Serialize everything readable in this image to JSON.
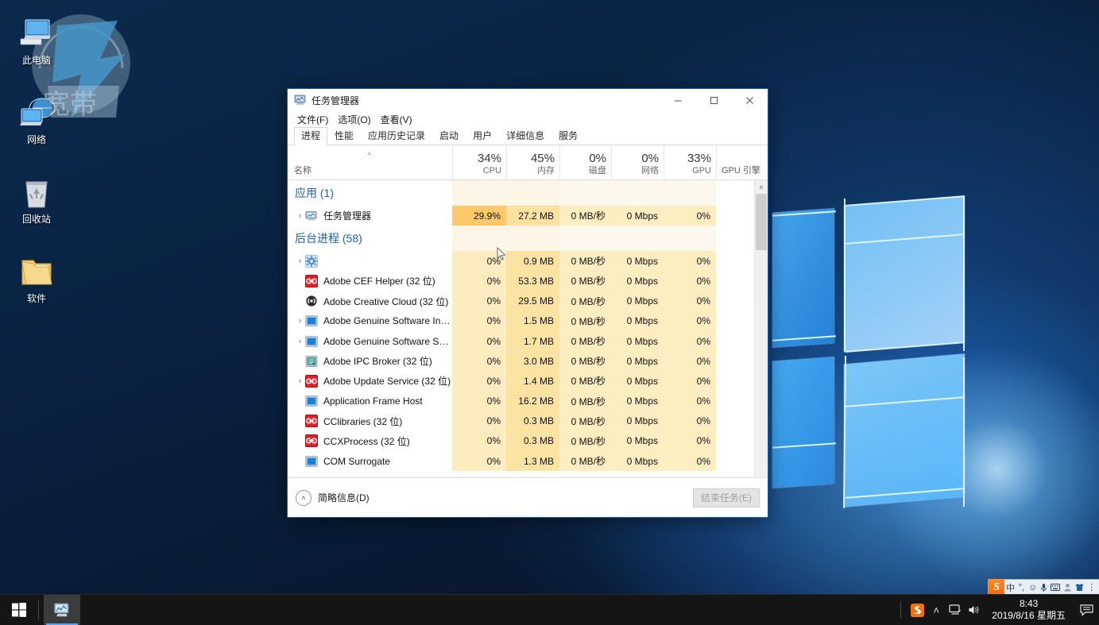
{
  "desktop": {
    "icons": [
      {
        "label": "此电脑",
        "icon": "this-pc-icon"
      },
      {
        "label": "网络",
        "icon": "network-icon"
      },
      {
        "label": "回收站",
        "icon": "recycle-bin-icon"
      },
      {
        "label": "软件",
        "icon": "folder-icon"
      }
    ]
  },
  "taskbar": {
    "start_label": "开始",
    "apps": [
      {
        "label": "任务管理器",
        "icon": "task-manager-icon"
      }
    ],
    "tray": {
      "sogou_icon": "sogou-pinyin-icon",
      "chevron": "˄",
      "network_icon": "network-tray-icon",
      "volume_icon": "volume-tray-icon",
      "notification_icon": "action-center-icon"
    },
    "clock": {
      "time": "8:43",
      "date": "2019/8/16 星期五"
    }
  },
  "ime_bar": {
    "logo": "S",
    "items": [
      {
        "label": "中",
        "name": "ime-mode-chinese"
      },
      {
        "label": "°,",
        "name": "ime-punctuation"
      },
      {
        "label": "☺",
        "name": "ime-emoji"
      },
      {
        "label": "🎤",
        "name": "ime-voice"
      },
      {
        "label": "⌨",
        "name": "ime-softkeyboard"
      },
      {
        "label": "👤",
        "name": "ime-user"
      },
      {
        "label": "👕",
        "name": "ime-skin"
      },
      {
        "label": "⋮",
        "name": "ime-menu"
      }
    ]
  },
  "task_manager": {
    "title": "任务管理器",
    "window_buttons": {
      "minimize": "─",
      "maximize": "☐",
      "close": "✕"
    },
    "menu": [
      "文件(F)",
      "选项(O)",
      "查看(V)"
    ],
    "tabs": [
      {
        "label": "进程",
        "active": true
      },
      {
        "label": "性能",
        "active": false
      },
      {
        "label": "应用历史记录",
        "active": false
      },
      {
        "label": "启动",
        "active": false
      },
      {
        "label": "用户",
        "active": false
      },
      {
        "label": "详细信息",
        "active": false
      },
      {
        "label": "服务",
        "active": false
      }
    ],
    "columns": [
      {
        "pct": "",
        "sub": "名称",
        "name": "column-name"
      },
      {
        "pct": "34%",
        "sub": "CPU",
        "name": "column-cpu"
      },
      {
        "pct": "45%",
        "sub": "内存",
        "name": "column-memory"
      },
      {
        "pct": "0%",
        "sub": "磁盘",
        "name": "column-disk"
      },
      {
        "pct": "0%",
        "sub": "网络",
        "name": "column-network"
      },
      {
        "pct": "33%",
        "sub": "GPU",
        "name": "column-gpu"
      },
      {
        "pct": "",
        "sub": "GPU 引擎",
        "name": "column-gpu-engine"
      }
    ],
    "rows": [
      {
        "type": "group",
        "label": "应用 (1)"
      },
      {
        "type": "proc",
        "expand": true,
        "icon": "task-manager-icon",
        "name": "任务管理器",
        "cpu": "29.9%",
        "mem": "27.2 MB",
        "disk": "0 MB/秒",
        "net": "0 Mbps",
        "gpu": "0%",
        "highlight": "hot"
      },
      {
        "type": "group",
        "label": "后台进程 (58)"
      },
      {
        "type": "proc",
        "expand": true,
        "icon": "settings-gear-icon",
        "name": "",
        "cpu": "0%",
        "mem": "0.9 MB",
        "disk": "0 MB/秒",
        "net": "0 Mbps",
        "gpu": "0%",
        "highlight": "warm"
      },
      {
        "type": "proc",
        "expand": false,
        "icon": "adobe-red-icon",
        "name": "Adobe CEF Helper (32 位)",
        "cpu": "0%",
        "mem": "53.3 MB",
        "disk": "0 MB/秒",
        "net": "0 Mbps",
        "gpu": "0%",
        "highlight": "warm"
      },
      {
        "type": "proc",
        "expand": false,
        "icon": "adobe-cc-icon",
        "name": "Adobe Creative Cloud (32 位)",
        "cpu": "0%",
        "mem": "29.5 MB",
        "disk": "0 MB/秒",
        "net": "0 Mbps",
        "gpu": "0%",
        "highlight": "warm"
      },
      {
        "type": "proc",
        "expand": true,
        "icon": "blue-app-icon",
        "name": "Adobe Genuine Software Inte...",
        "cpu": "0%",
        "mem": "1.5 MB",
        "disk": "0 MB/秒",
        "net": "0 Mbps",
        "gpu": "0%",
        "highlight": "warm"
      },
      {
        "type": "proc",
        "expand": true,
        "icon": "blue-app-icon",
        "name": "Adobe Genuine Software Ser...",
        "cpu": "0%",
        "mem": "1.7 MB",
        "disk": "0 MB/秒",
        "net": "0 Mbps",
        "gpu": "0%",
        "highlight": "warm"
      },
      {
        "type": "proc",
        "expand": false,
        "icon": "teal-doc-icon",
        "name": "Adobe IPC Broker (32 位)",
        "cpu": "0%",
        "mem": "3.0 MB",
        "disk": "0 MB/秒",
        "net": "0 Mbps",
        "gpu": "0%",
        "highlight": "warm"
      },
      {
        "type": "proc",
        "expand": true,
        "icon": "adobe-red-icon",
        "name": "Adobe Update Service (32 位)",
        "cpu": "0%",
        "mem": "1.4 MB",
        "disk": "0 MB/秒",
        "net": "0 Mbps",
        "gpu": "0%",
        "highlight": "warm"
      },
      {
        "type": "proc",
        "expand": false,
        "icon": "blue-app-icon",
        "name": "Application Frame Host",
        "cpu": "0%",
        "mem": "16.2 MB",
        "disk": "0 MB/秒",
        "net": "0 Mbps",
        "gpu": "0%",
        "highlight": "warm"
      },
      {
        "type": "proc",
        "expand": false,
        "icon": "adobe-red-icon",
        "name": "CClibraries (32 位)",
        "cpu": "0%",
        "mem": "0.3 MB",
        "disk": "0 MB/秒",
        "net": "0 Mbps",
        "gpu": "0%",
        "highlight": "warm"
      },
      {
        "type": "proc",
        "expand": false,
        "icon": "adobe-red-icon",
        "name": "CCXProcess (32 位)",
        "cpu": "0%",
        "mem": "0.3 MB",
        "disk": "0 MB/秒",
        "net": "0 Mbps",
        "gpu": "0%",
        "highlight": "warm"
      },
      {
        "type": "proc",
        "expand": false,
        "icon": "blue-app-icon",
        "name": "COM Surrogate",
        "cpu": "0%",
        "mem": "1.3 MB",
        "disk": "0 MB/秒",
        "net": "0 Mbps",
        "gpu": "0%",
        "highlight": "warm"
      }
    ],
    "status": {
      "fewer_details": "简略信息(D)",
      "end_task": "结束任务(E)"
    },
    "scroll": {
      "up": "˄",
      "down": "˅",
      "left": "‹",
      "right": "›"
    }
  },
  "colors": {
    "accent_blue": "#1f5fa9",
    "heat_hot": "#fcc96a",
    "heat_warm": "#fbe6a8",
    "heat_warm2": "#fdeec2",
    "taskbar": "#151515"
  }
}
